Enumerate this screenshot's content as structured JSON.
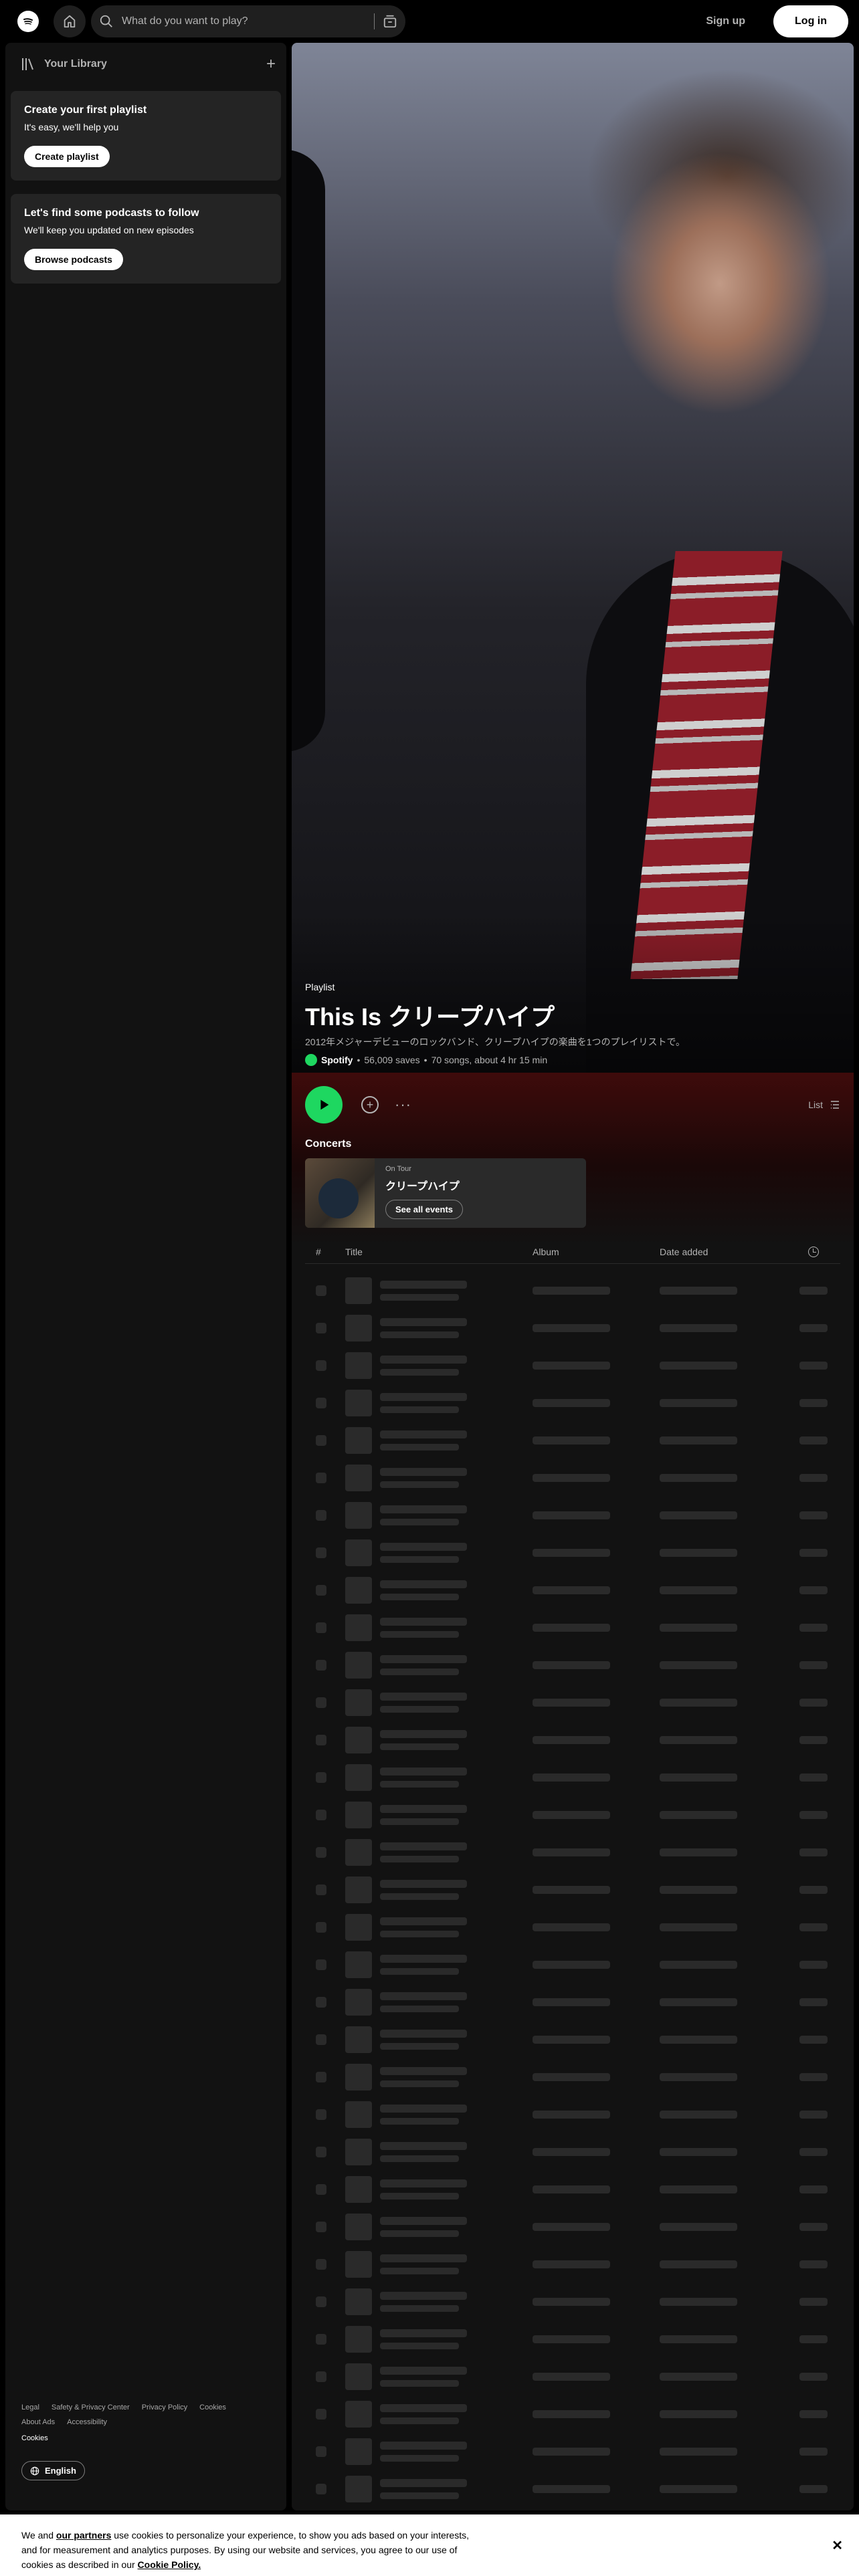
{
  "topbar": {
    "search_placeholder": "What do you want to play?",
    "signup_label": "Sign up",
    "login_label": "Log in"
  },
  "sidebar": {
    "library_title": "Your Library",
    "cards": [
      {
        "title": "Create your first playlist",
        "text": "It's easy, we'll help you",
        "button": "Create playlist"
      },
      {
        "title": "Let's find some podcasts to follow",
        "text": "We'll keep you updated on new episodes",
        "button": "Browse podcasts"
      }
    ],
    "footer_links": [
      "Legal",
      "Safety & Privacy Center",
      "Privacy Policy",
      "Cookies",
      "About Ads",
      "Accessibility"
    ],
    "footer_cookies": "Cookies",
    "language": "English"
  },
  "playlist": {
    "type": "Playlist",
    "title": "This Is クリープハイプ",
    "description": "2012年メジャーデビューのロックバンド、クリープハイプの楽曲を1つのプレイリストで。",
    "owner": "Spotify",
    "saves": "56,009 saves",
    "summary": "70 songs, about 4 hr 15 min"
  },
  "actions": {
    "view_label": "List"
  },
  "concerts": {
    "heading": "Concerts",
    "tour_label": "On Tour",
    "artist": "クリープハイプ",
    "button": "See all events"
  },
  "track_table": {
    "columns": [
      "#",
      "Title",
      "Album",
      "Date added"
    ],
    "loading_rows": 33
  },
  "cookie_banner": {
    "text_a": "We and",
    "partners_link": "our partners",
    "text_b": "use cookies to personalize your experience, to show you ads based on your interests, and for measurement and analytics purposes. By using our website and services, you agree to our use of cookies as described in our",
    "policy_link": "Cookie Policy."
  },
  "colors": {
    "accent": "#1ed760",
    "background": "#000000",
    "panel": "#121212",
    "hero_tint": "#3e0b0b"
  },
  "icons": [
    "spotify-logo-icon",
    "home-icon",
    "search-icon",
    "browse-icon",
    "library-icon",
    "plus-icon",
    "play-icon",
    "add-circle-icon",
    "more-icon",
    "list-icon",
    "clock-icon",
    "globe-icon",
    "close-icon"
  ]
}
